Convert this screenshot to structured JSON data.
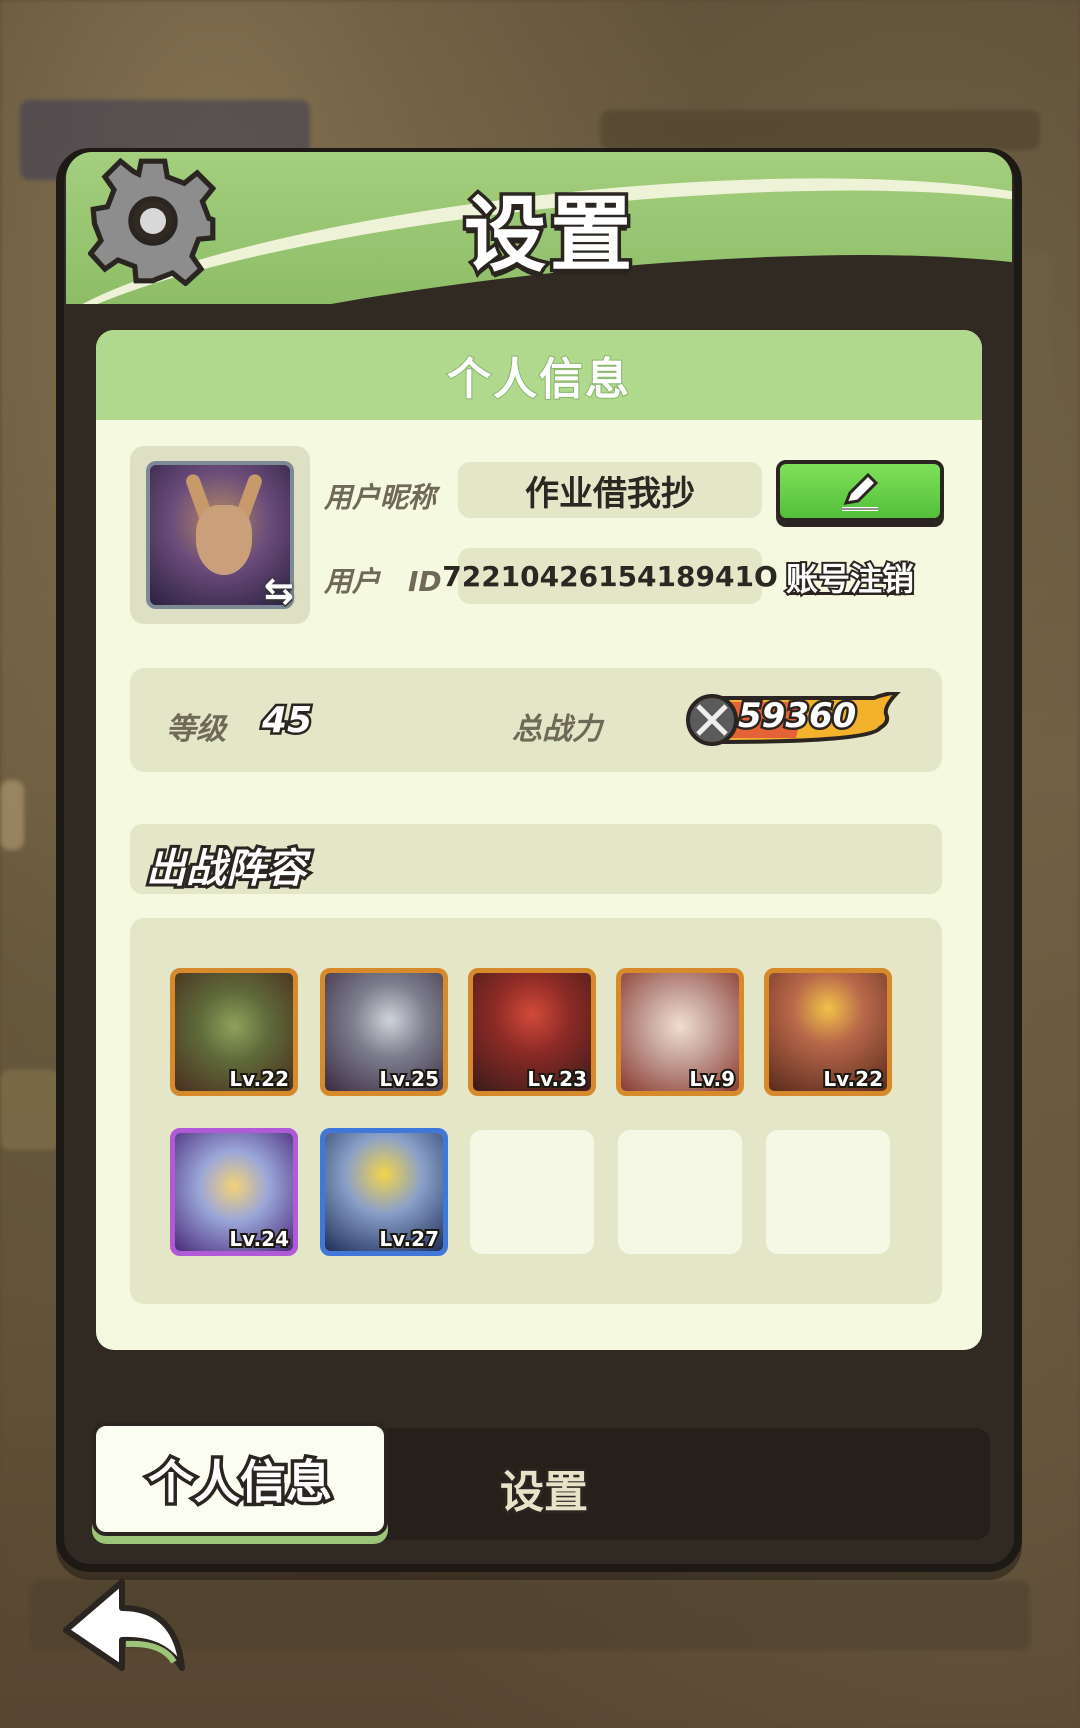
{
  "window": {
    "title": "设置"
  },
  "profile": {
    "section_title": "个人信息",
    "nickname_label": "用户昵称",
    "nickname": "作业借我抄",
    "id_label": "用户　ID",
    "user_id": "7221042615418941O",
    "logout_label": "账号注销"
  },
  "stats": {
    "level_label": "等级",
    "level": "45",
    "power_label": "总战力",
    "power": "59360"
  },
  "lineup": {
    "title": "出战阵容",
    "heroes": [
      {
        "level": "Lv.22",
        "frame": "orange",
        "icon": "crocodile-hero"
      },
      {
        "level": "Lv.25",
        "frame": "orange",
        "icon": "mage-hero"
      },
      {
        "level": "Lv.23",
        "frame": "orange",
        "icon": "redhair-hero"
      },
      {
        "level": "Lv.9",
        "frame": "orange",
        "icon": "antler-girl-hero"
      },
      {
        "level": "Lv.22",
        "frame": "orange",
        "icon": "king-hero"
      },
      {
        "level": "Lv.24",
        "frame": "purple",
        "icon": "fairy-hero"
      },
      {
        "level": "Lv.27",
        "frame": "blue",
        "icon": "blond-knight-hero"
      }
    ],
    "empty_slots": 3
  },
  "tabs": {
    "profile": "个人信息",
    "settings": "设置"
  },
  "colors": {
    "header_green": "#a4cf7e",
    "card_bg": "#f5f9e0",
    "edit_button": "#6ad44a",
    "frame_orange": "#d78a2c",
    "frame_purple": "#b05ad8",
    "frame_blue": "#3f78d8"
  }
}
